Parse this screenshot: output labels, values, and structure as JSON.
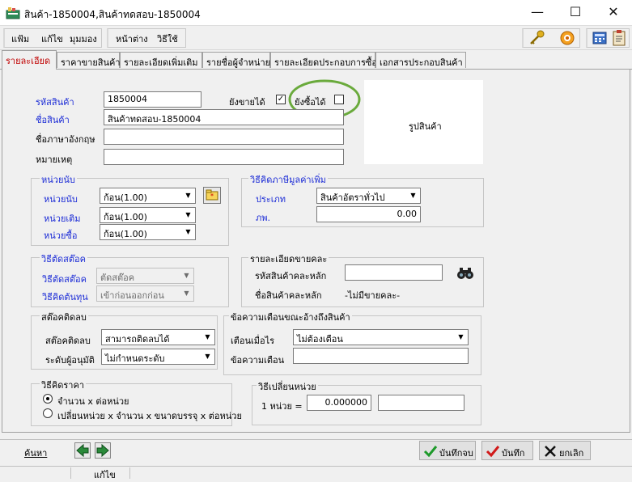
{
  "window": {
    "title": "สินค้า-1850004,สินค้าทดสอบ-1850004"
  },
  "menu": {
    "items": [
      "แฟ้ม",
      "แก้ไข",
      "มุมมอง",
      "หน้าต่าง",
      "วิธีใช้"
    ]
  },
  "tabs": [
    "รายละเอียด",
    "ราคาขายสินค้า",
    "รายละเอียดเพิ่มเติม",
    "รายชื่อผู้จำหน่าย",
    "รายละเอียดประกอบการซื้อ",
    "เอกสารประกอบสินค้า"
  ],
  "general": {
    "product_code_label": "รหัสสินค้า",
    "product_code": "1850004",
    "can_sell_label": "ยังขายได้",
    "can_sell_checked": "✓",
    "can_buy_label": "ยังซื้อได้",
    "product_name_label": "ชื่อสินค้า",
    "product_name": "สินค้าทดสอบ-1850004",
    "english_name_label": "ชื่อภาษาอังกฤษ",
    "english_name": "",
    "note_label": "หมายเหตุ",
    "note": "",
    "picture_label": "รูปสินค้า"
  },
  "units": {
    "group_title": "หน่วยนับ",
    "unit_label": "หน่วยนับ",
    "unit_value": "ก้อน(1.00)",
    "std_unit_label": "หน่วยเติม",
    "std_unit_value": "ก้อน(1.00)",
    "buy_unit_label": "หน่วยซื้อ",
    "buy_unit_value": "ก้อน(1.00)"
  },
  "vat": {
    "group_title": "วิธีคิดภาษีมูลค่าเพิ่ม",
    "type_label": "ประเภท",
    "type_value": "สินค้าอัตราทั่วไป",
    "rate_label": "ภพ.",
    "rate_value": "0.00"
  },
  "stock_cut": {
    "group_title": "วิธีตัดสต๊อค",
    "method_label": "วิธีตัดสต๊อค",
    "method_value": "ตัดสต๊อค",
    "cost_label": "วิธีคิดต้นทุน",
    "cost_value": "เข้าก่อนออกก่อน"
  },
  "bundle": {
    "group_title": "รายละเอียดขายคละ",
    "main_code_label": "รหัสสินค้าคละหลัก",
    "main_code_value": "",
    "main_name_label": "ชื่อสินค้าคละหลัก",
    "main_name_value": "-ไม่มีขายคละ-"
  },
  "negative_stock": {
    "group_title": "สต๊อคติดลบ",
    "label": "สต๊อคติดลบ",
    "value": "สามารถติดลบได้",
    "approver_label": "ระดับผู้อนุมัติ",
    "approver_value": "ไม่กำหนดระดับ"
  },
  "warning": {
    "group_title": "ข้อความเตือนขณะอ้างถึงสินค้า",
    "when_label": "เตือนเมื่อไร",
    "when_value": "ไม่ต้องเตือน",
    "message_label": "ข้อความเตือน",
    "message_value": ""
  },
  "pricing": {
    "group_title": "วิธีคิดราคา",
    "option1": "จำนวน x ต่อหน่วย",
    "option2": "เปลี่ยนหน่วย x จำนวน x ขนาดบรรจุ x ต่อหน่วย",
    "selected": "option1"
  },
  "unit_change": {
    "group_title": "วิธีเปลี่ยนหน่วย",
    "label": "1 หน่วย =",
    "value": "0.000000",
    "extra": ""
  },
  "footer": {
    "search_label": "ค้นหา",
    "save_close_label": "บันทึกจบ",
    "save_label": "บันทึก",
    "cancel_label": "ยกเลิก"
  },
  "status": {
    "mode": "แก้ไข"
  },
  "colors": {
    "label_blue": "#1b2bd6",
    "active_tab": "#c00000",
    "highlight_circle": "#6aaa3c"
  }
}
